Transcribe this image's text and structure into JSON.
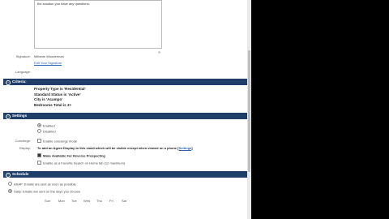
{
  "email": {
    "body_tail": "the solution you have any questions.",
    "signature_label": "Signature:",
    "signature_value": "Melanie Wooderman",
    "edit_signature_link": "Edit Your Signature",
    "language_label": "Language:"
  },
  "criteria": {
    "header": "Criteria:",
    "lines": [
      "Property Type is 'Residential'",
      "Standard Status is 'Active'",
      "City is 'Acampo'",
      "Bedrooms Total is 3+"
    ]
  },
  "settings": {
    "header": "Settings",
    "status_options": [
      "Enabled",
      "Disabled"
    ],
    "concierge_label": "Concierge:",
    "concierge_option": "Enable concierge mode",
    "display_label": "Display:",
    "display_text": "To add an Agent Display to this email which will be visible except when viewed on a phone [",
    "display_link": "Settings",
    "display_close": "]",
    "reverse_option": "Make Available For Reverse Prospecting",
    "favorite_option": "Enable as a Favorite Search on Home tab (12 maximum)"
  },
  "schedule": {
    "header": "Schedule",
    "asap_option": "ASAP: Emails are sent as soon as possible",
    "daily_option": "Daily: Emails are sent on the days you choose",
    "days": [
      "Sun",
      "Mon",
      "Tue",
      "Wed",
      "Thu",
      "Fri",
      "Sat"
    ]
  }
}
